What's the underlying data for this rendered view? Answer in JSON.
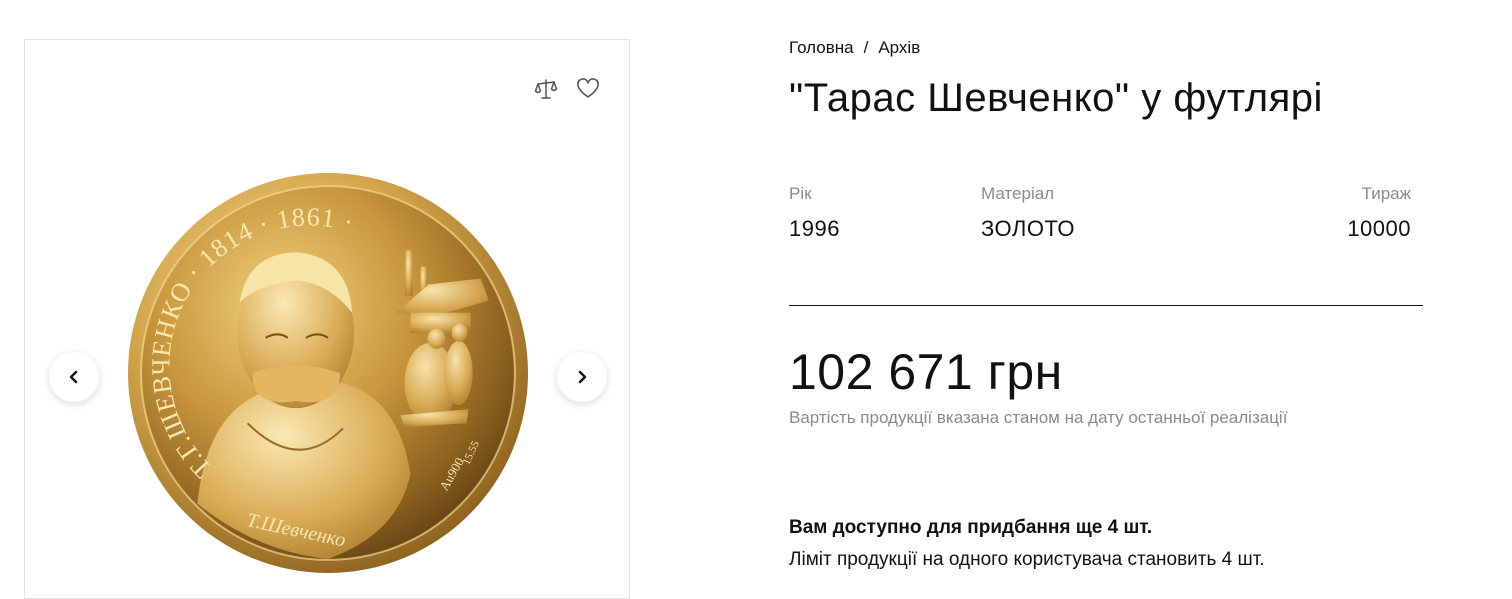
{
  "breadcrumb": {
    "home": "Головна",
    "separator": "/",
    "current": "Архів"
  },
  "product": {
    "title": "\"Тарас Шевченко\" у футлярі",
    "year_label": "Рік",
    "year": "1996",
    "material_label": "Матеріал",
    "material": "ЗОЛОТО",
    "mintage_label": "Тираж",
    "mintage": "10000",
    "price": "102 671 грн",
    "price_note": "Вартість продукції вказана станом на дату останньої реалізації",
    "availability": "Вам доступно для придбання ще 4 шт.",
    "limit": "Ліміт продукції на одного користувача становить 4 шт."
  },
  "coin": {
    "inscription": "Т.Г.ШЕВЧЕНКО · 1814 · 1861 ·",
    "signature": "Т.Шевченко",
    "metal_mark": "Au900",
    "weight_mark": "15.55"
  },
  "icons": {
    "compare": "compare-scales-icon",
    "favorite": "heart-icon",
    "prev": "chevron-left-icon",
    "next": "chevron-right-icon"
  },
  "colors": {
    "gold_light": "#f3d98a",
    "gold_mid": "#c99a3e",
    "gold_dark": "#7a5317",
    "text": "#111111",
    "muted": "#8a8a8a"
  }
}
